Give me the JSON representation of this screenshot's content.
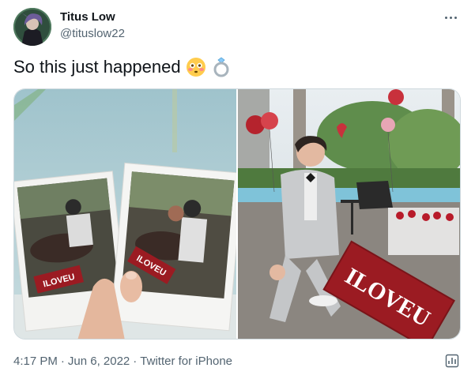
{
  "tweet": {
    "display_name": "Titus Low",
    "handle": "@tituslow22",
    "text": "So this just happened",
    "emojis": [
      "flushed-face-emoji",
      "ring-emoji"
    ],
    "time": "4:17 PM",
    "date": "Jun 6, 2022",
    "separator": "·",
    "source": "Twitter for iPhone"
  },
  "media": {
    "photo_left": {
      "sign_text": "ILOVEU"
    },
    "photo_right": {
      "sign_text": "ILOVEU"
    }
  },
  "icons": {
    "more": "more-dots-icon",
    "analytics": "view-activity-icon"
  },
  "colors": {
    "primary_text": "#0f1419",
    "secondary_text": "#536471",
    "border": "#cfd9de",
    "sign_red": "#9b1b22"
  }
}
